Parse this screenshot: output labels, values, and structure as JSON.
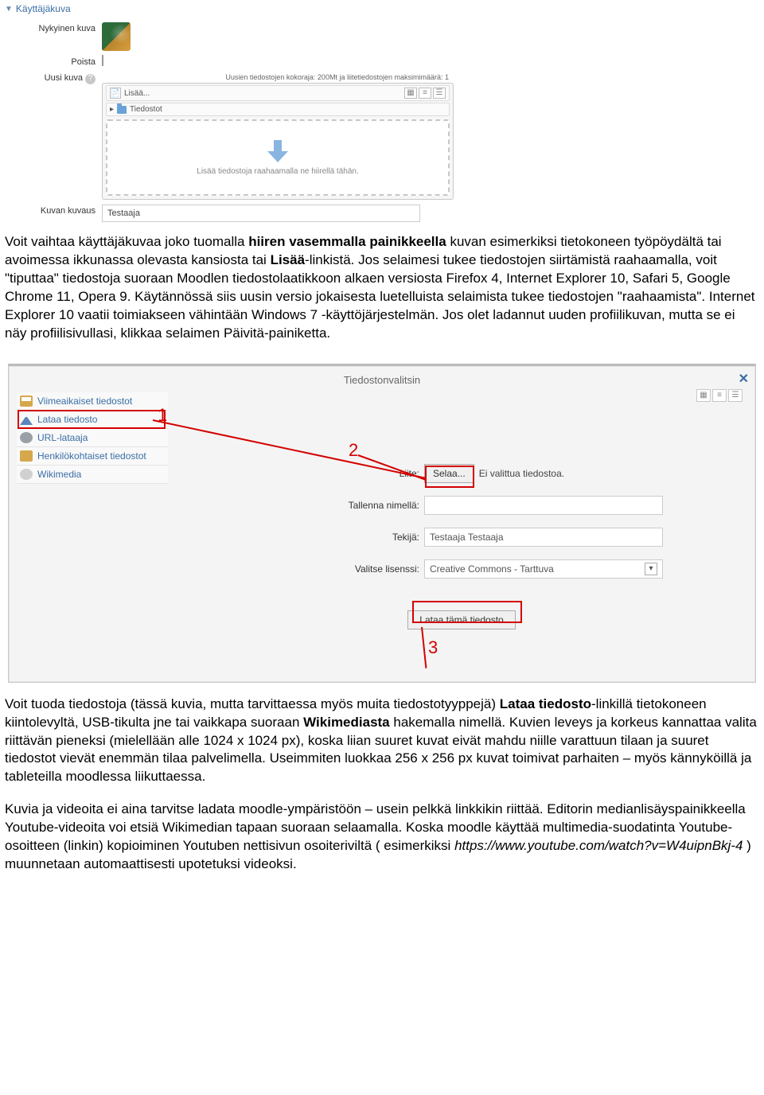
{
  "section1": {
    "legend": "Käyttäjäkuva",
    "current_image_label": "Nykyinen kuva",
    "delete_label": "Poista",
    "new_image_label": "Uusi kuva",
    "file_help": "Uusien tiedostojen kokoraja: 200Mt ja liitetiedostojen maksimimäärä: 1",
    "add_button": "Lisää...",
    "files_tree": "Tiedostot",
    "dropzone_text": "Lisää tiedostoja raahaamalla ne hiirellä tähän.",
    "description_label": "Kuvan kuvaus",
    "description_value": "Testaaja"
  },
  "para1_a": "Voit vaihtaa käyttäjäkuvaa joko tuomalla ",
  "para1_b": "hiiren vasemmalla painikkeella",
  "para1_c": " kuvan esimerkiksi tietokoneen työpöydältä tai avoimessa ikkunassa olevasta kansiosta  tai ",
  "para1_d": "Lisää",
  "para1_e": "-linkistä. Jos selaimesi tukee tiedostojen siirtämistä raahaamalla, voit \"tiputtaa\" tiedostoja suoraan Moodlen tiedostolaatikkoon  alkaen versiosta Firefox 4, Internet Explorer 10, Safari 5, Google Chrome 11, Opera 9. Käytännössä siis uusin versio jokaisesta luetelluista selaimista tukee tiedostojen \"raahaamista\". Internet Explorer 10 vaatii toimiakseen vähintään Windows 7 -käyttöjärjestelmän. Jos olet ladannut uuden profiilikuvan, mutta se ei näy profiilisivullasi, klikkaa selaimen Päivitä-painiketta.",
  "fp": {
    "title": "Tiedostonvalitsin",
    "side": {
      "recent": "Viimeaikaiset tiedostot",
      "upload": "Lataa tiedosto",
      "url": "URL-lataaja",
      "personal": "Henkilökohtaiset tiedostot",
      "wiki": "Wikimedia"
    },
    "attach_label": "Liite:",
    "browse_button": "Selaa...",
    "no_file": "Ei valittua tiedostoa.",
    "saveas_label": "Tallenna nimellä:",
    "author_label": "Tekijä:",
    "author_value": "Testaaja Testaaja",
    "license_label": "Valitse lisenssi:",
    "license_value": "Creative Commons - Tarttuva",
    "submit": "Lataa tämä tiedosto"
  },
  "anno": {
    "l1": "1",
    "l2": "2",
    "l3": "3"
  },
  "para2_a": "Voit tuoda tiedostoja (tässä kuvia, mutta tarvittaessa myös muita tiedostotyyppejä) ",
  "para2_b": "Lataa tiedosto",
  "para2_c": "-linkillä tietokoneen kiintolevyltä, USB-tikulta jne tai vaikkapa suoraan ",
  "para2_d": "Wikimediasta",
  "para2_e": " hakemalla nimellä. Kuvien leveys ja korkeus kannattaa valita riittävän pieneksi  (mielellään alle 1024 x 1024 px), koska liian suuret kuvat eivät mahdu niille varattuun tilaan ja suuret tiedostot vievät enemmän tilaa palvelimella. Useimmiten luokkaa 256 x 256 px kuvat toimivat parhaiten – myös kännyköillä ja tableteilla moodlessa liikuttaessa.",
  "para3_a": "Kuvia ja videoita ei aina tarvitse ladata moodle-ympäristöön – usein pelkkä linkkikin riittää. Editorin medianlisäyspainikkeella Youtube-videoita voi etsiä Wikimedian tapaan suoraan selaamalla. Koska moodle käyttää multimedia-suodatinta Youtube-osoitteen (linkin) kopioiminen Youtuben nettisivun osoiteriviltä ( esimerkiksi ",
  "para3_b": "https://www.youtube.com/watch?v=W4uipnBkj-4",
  "para3_c": " ) muunnetaan automaattisesti upotetuksi videoksi."
}
